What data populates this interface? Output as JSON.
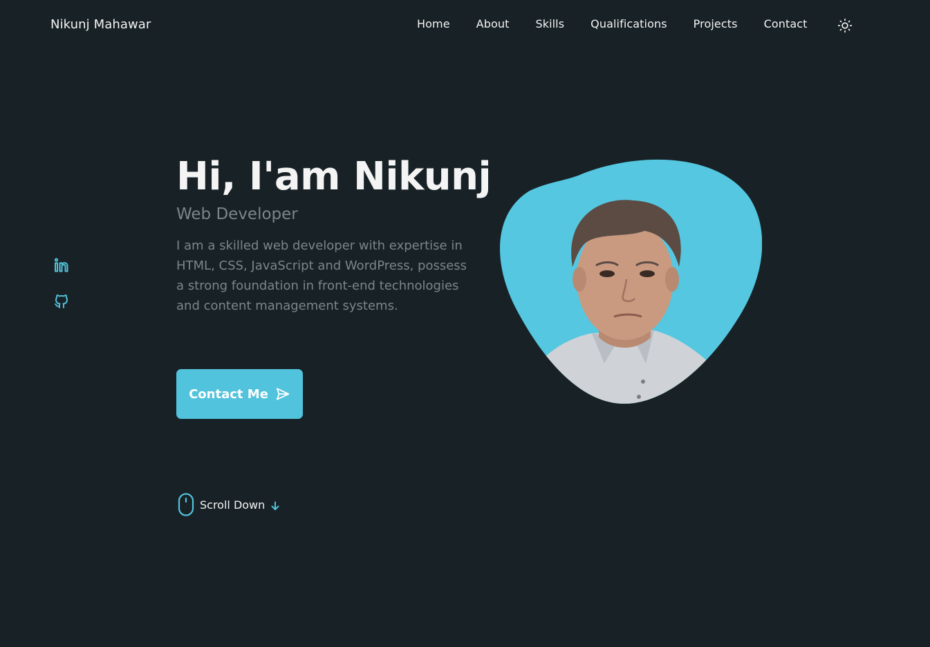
{
  "header": {
    "logo": "Nikunj Mahawar",
    "nav": [
      {
        "label": "Home"
      },
      {
        "label": "About"
      },
      {
        "label": "Skills"
      },
      {
        "label": "Qualifications"
      },
      {
        "label": "Projects"
      },
      {
        "label": "Contact"
      }
    ],
    "theme_toggle_icon": "sun-icon"
  },
  "social": [
    {
      "icon": "linkedin-icon"
    },
    {
      "icon": "github-icon"
    }
  ],
  "hero": {
    "title": "Hi, I'am Nikunj",
    "subtitle": "Web Developer",
    "description": "I am a skilled web developer with expertise in HTML, CSS, JavaScript and WordPress, possess a strong foundation in front-end technologies and content management systems.",
    "cta_label": "Contact Me",
    "cta_icon": "send-icon"
  },
  "scroll": {
    "label": "Scroll Down",
    "icon": "mouse-icon",
    "arrow_icon": "arrow-down-icon"
  },
  "colors": {
    "background": "#182226",
    "accent": "#52c3dc",
    "text": "#f4f4f4",
    "muted_text": "#7c8689"
  }
}
